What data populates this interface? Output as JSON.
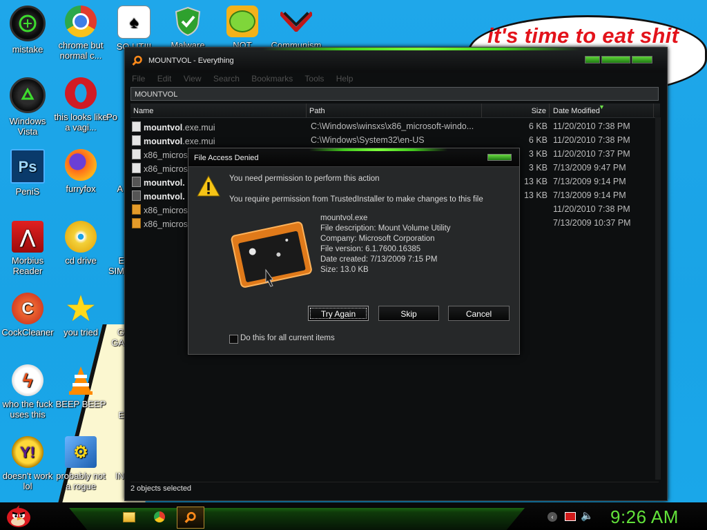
{
  "desktop": {
    "speech_bubble": "it's time to eat shit",
    "icons": [
      {
        "label": "mistake",
        "icon": "razer-icon"
      },
      {
        "label": "chrome but normal c...",
        "icon": "chrome-icon"
      },
      {
        "label": "SO UTIII",
        "icon": "solitaire-icon"
      },
      {
        "label": "Malware",
        "icon": "shield-icon"
      },
      {
        "label": "NOT",
        "icon": "bad-piggies-icon"
      },
      {
        "label": "Communism",
        "icon": "flag-icon"
      },
      {
        "label": "Windows Vista",
        "icon": "recycle-icon"
      },
      {
        "label": "this looks like a vagi...",
        "icon": "opera-icon"
      },
      {
        "label": "Po",
        "icon": "partial-icon"
      },
      {
        "label": "PeniS",
        "icon": "photoshop-icon"
      },
      {
        "label": "furryfox",
        "icon": "firefox-icon"
      },
      {
        "label": "A",
        "icon": "partial-icon"
      },
      {
        "label": "Morbius Reader",
        "icon": "acrobat-icon"
      },
      {
        "label": "cd drive",
        "icon": "cd-icon"
      },
      {
        "label": "E SIM",
        "icon": "partial-icon"
      },
      {
        "label": "CockCleaner",
        "icon": "ccleaner-icon"
      },
      {
        "label": "you tried",
        "icon": "star-icon"
      },
      {
        "label": "G GA",
        "icon": "partial-icon"
      },
      {
        "label": "who the fuck uses this",
        "icon": "flash-icon"
      },
      {
        "label": "BEEP BEEP",
        "icon": "vlc-icon"
      },
      {
        "label": "E",
        "icon": "partial-icon"
      },
      {
        "label": "doesn't work lol",
        "icon": "yahoo-icon"
      },
      {
        "label": "probably not a rogue",
        "icon": "control-panel-icon"
      },
      {
        "label": "IN",
        "icon": "partial-icon"
      }
    ]
  },
  "everything_window": {
    "title": "MOUNTVOL - Everything",
    "menu": [
      "File",
      "Edit",
      "View",
      "Search",
      "Bookmarks",
      "Tools",
      "Help"
    ],
    "search_value": "MOUNTVOL",
    "columns": {
      "name": "Name",
      "path": "Path",
      "size": "Size",
      "date": "Date Modified"
    },
    "rows": [
      {
        "bold": "mountvol",
        "rest": ".exe.mui",
        "path": "C:\\Windows\\winsxs\\x86_microsoft-windo...",
        "size": "6 KB",
        "date": "11/20/2010 7:38 PM",
        "icon": "file-icon"
      },
      {
        "bold": "mountvol",
        "rest": ".exe.mui",
        "path": "C:\\Windows\\System32\\en-US",
        "size": "6 KB",
        "date": "11/20/2010 7:38 PM",
        "icon": "file-icon"
      },
      {
        "bold": "",
        "rest": "x86_micros",
        "path": "",
        "size": "3 KB",
        "date": "11/20/2010 7:37 PM",
        "icon": "file-icon"
      },
      {
        "bold": "",
        "rest": "x86_micros",
        "path": "",
        "size": "3 KB",
        "date": "7/13/2009 9:47 PM",
        "icon": "file-icon"
      },
      {
        "bold": "mountvol.",
        "rest": "",
        "path": "",
        "size": "13 KB",
        "date": "7/13/2009 9:14 PM",
        "icon": "exe-icon"
      },
      {
        "bold": "mountvol.",
        "rest": "",
        "path": "",
        "size": "13 KB",
        "date": "7/13/2009 9:14 PM",
        "icon": "exe-icon"
      },
      {
        "bold": "",
        "rest": "x86_micros",
        "path": "",
        "size": "",
        "date": "11/20/2010 7:38 PM",
        "icon": "folder-icon"
      },
      {
        "bold": "",
        "rest": "x86_micros",
        "path": "",
        "size": "",
        "date": "7/13/2009 10:37 PM",
        "icon": "folder-icon"
      }
    ],
    "status": "2 objects selected"
  },
  "dialog": {
    "title": "File Access Denied",
    "line1": "You need permission to perform this action",
    "line2": "You require permission from TrustedInstaller to make changes to this file",
    "file_name": "mountvol.exe",
    "description": "File description: Mount Volume Utility",
    "company": "Company: Microsoft Corporation",
    "version": "File version: 6.1.7600.16385",
    "created": "Date created: 7/13/2009 7:15 PM",
    "size": "Size: 13.0 KB",
    "buttons": {
      "try_again": "Try Again",
      "skip": "Skip",
      "cancel": "Cancel"
    },
    "checkbox_label": "Do this for all current items",
    "checkbox_checked": false
  },
  "taskbar": {
    "apps": [
      "explorer-icon",
      "chrome-icon",
      "everything-icon"
    ],
    "tray": [
      "arrow-icon",
      "action-center-icon",
      "speaker-icon"
    ],
    "clock": "9:26 AM",
    "accent": "#62e23a"
  }
}
